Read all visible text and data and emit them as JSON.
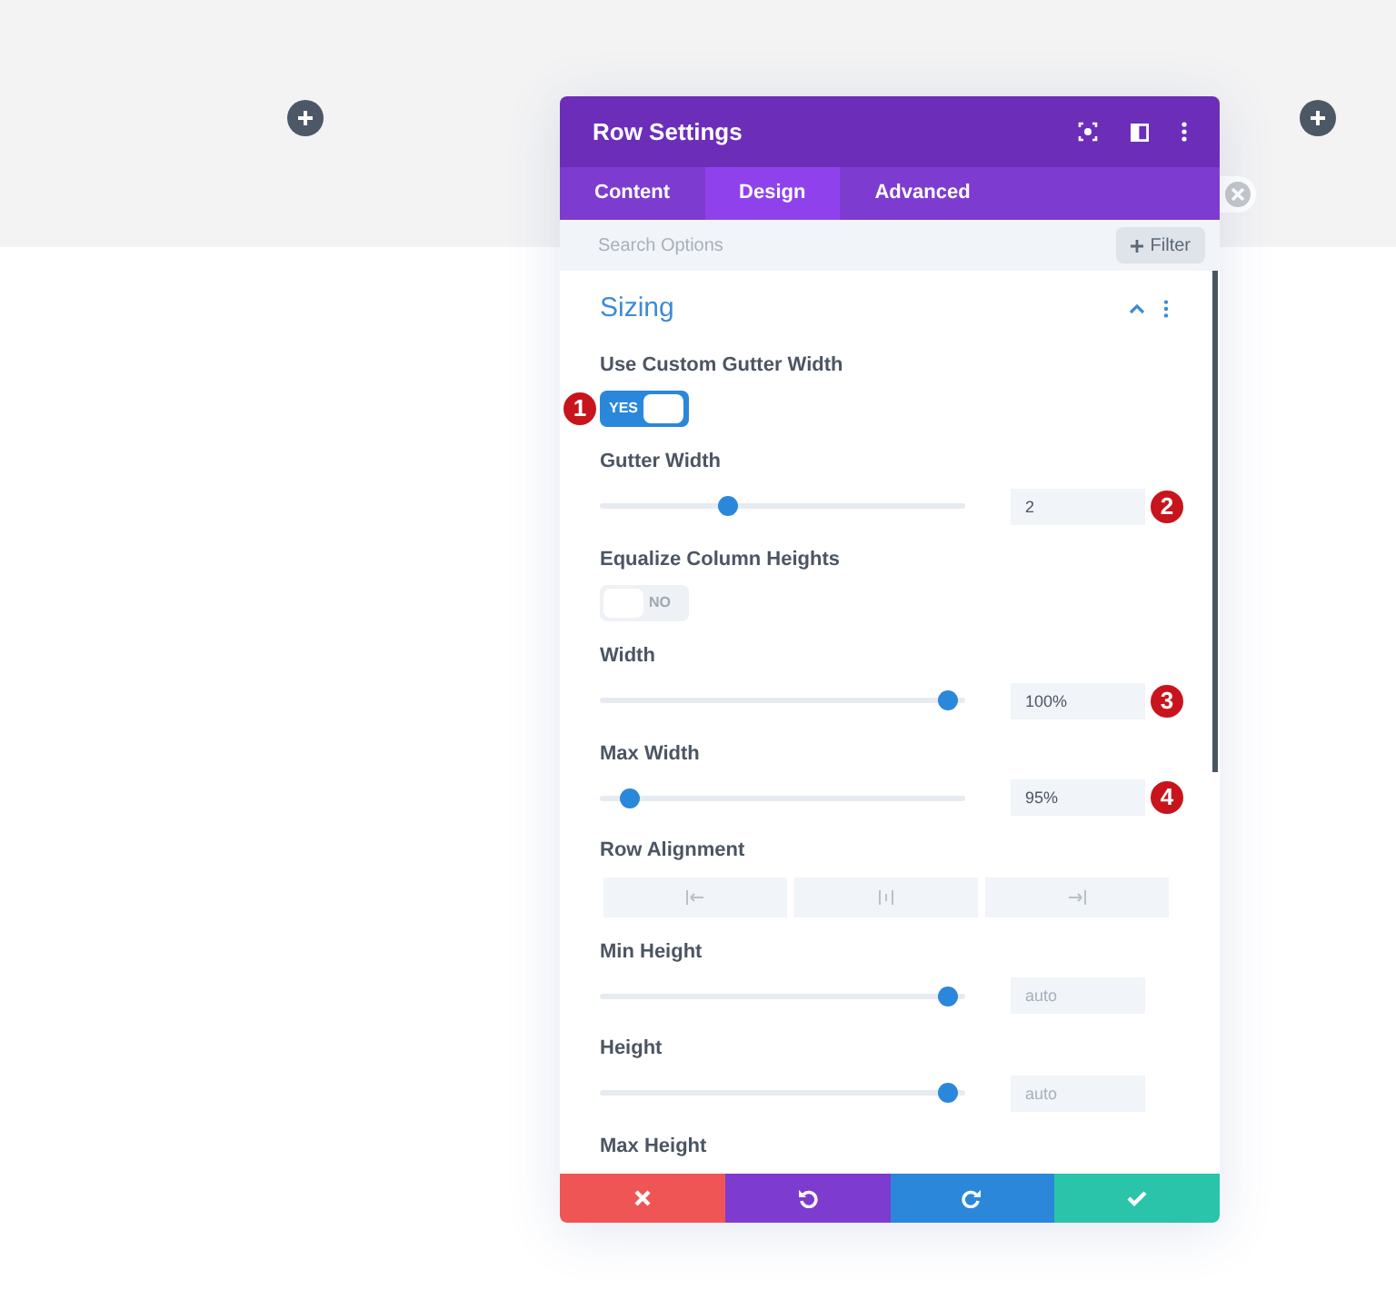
{
  "panel": {
    "title": "Row Settings"
  },
  "tabs": [
    {
      "label": "Content",
      "selected": false
    },
    {
      "label": "Design",
      "selected": true
    },
    {
      "label": "Advanced",
      "selected": false
    }
  ],
  "search": {
    "placeholder": "Search Options",
    "filter_label": "Filter"
  },
  "section": {
    "title": "Sizing",
    "expanded": true
  },
  "settings": [
    {
      "kind": "toggle",
      "label": "Use Custom Gutter Width",
      "on": true,
      "on_text": "YES",
      "badge": "1"
    },
    {
      "kind": "slider",
      "label": "Gutter Width",
      "level": 0.34,
      "value": "2",
      "badge": "2"
    },
    {
      "kind": "toggle",
      "label": "Equalize Column Heights",
      "on": false,
      "off_text": "NO"
    },
    {
      "kind": "slider",
      "label": "Width",
      "level": 0.98,
      "value": "100%",
      "badge": "3"
    },
    {
      "kind": "slider",
      "label": "Max Width",
      "level": 0.06,
      "value": "95%",
      "badge": "4"
    },
    {
      "kind": "alignment",
      "label": "Row Alignment"
    },
    {
      "kind": "slider",
      "label": "Min Height",
      "level": 0.98,
      "placeholder": "auto"
    },
    {
      "kind": "slider",
      "label": "Height",
      "level": 0.98,
      "placeholder": "auto"
    },
    {
      "kind": "heading",
      "label": "Max Height"
    }
  ]
}
